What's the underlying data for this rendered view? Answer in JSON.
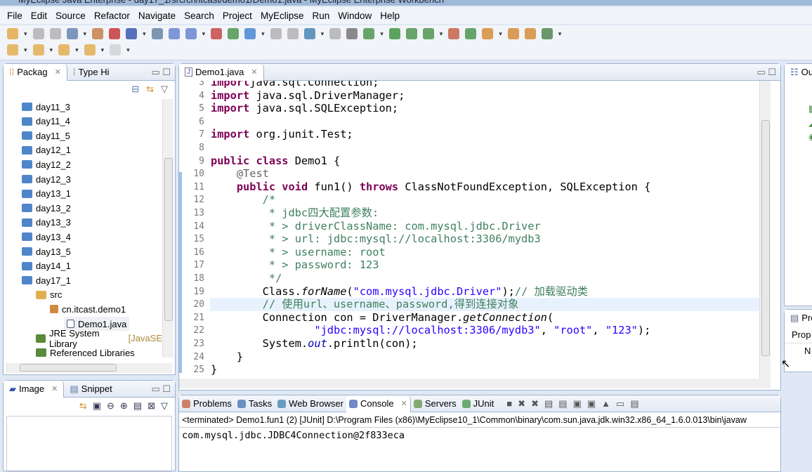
{
  "window": {
    "title": "MyEclipse Java Enterprise - day17_1/src/cn/itcast/demo1/Demo1.java - MyEclipse Enterprise Workbench"
  },
  "menu": [
    "File",
    "Edit",
    "Source",
    "Refactor",
    "Navigate",
    "Search",
    "Project",
    "MyEclipse",
    "Run",
    "Window",
    "Help"
  ],
  "package_explorer": {
    "tabs": [
      {
        "label": "Packag"
      },
      {
        "label": "Type Hi"
      }
    ],
    "items": [
      {
        "label": "day11_3",
        "depth": 0
      },
      {
        "label": "day11_4",
        "depth": 0
      },
      {
        "label": "day11_5",
        "depth": 0
      },
      {
        "label": "day12_1",
        "depth": 0
      },
      {
        "label": "day12_2",
        "depth": 0
      },
      {
        "label": "day12_3",
        "depth": 0
      },
      {
        "label": "day13_1",
        "depth": 0
      },
      {
        "label": "day13_2",
        "depth": 0
      },
      {
        "label": "day13_3",
        "depth": 0
      },
      {
        "label": "day13_4",
        "depth": 0
      },
      {
        "label": "day13_5",
        "depth": 0
      },
      {
        "label": "day14_1",
        "depth": 0
      },
      {
        "label": "day17_1",
        "depth": 0
      },
      {
        "label": "src",
        "depth": 1
      },
      {
        "label": "cn.itcast.demo1",
        "depth": 2
      },
      {
        "label": "Demo1.java",
        "depth": 3
      },
      {
        "label": "JRE System Library",
        "suffix": "[JavaSE",
        "depth": 1
      },
      {
        "label": "Referenced Libraries",
        "depth": 1
      }
    ]
  },
  "image_panel": {
    "tabs": [
      {
        "label": "Image"
      },
      {
        "label": "Snippet"
      }
    ]
  },
  "editor": {
    "tab": "Demo1.java",
    "highlighted_line": 20,
    "lines": [
      {
        "n": "3",
        "t": [
          [
            "kw",
            "import"
          ],
          [
            "",
            "java.sql.Connection;"
          ]
        ]
      },
      {
        "n": "4",
        "t": [
          [
            "kw",
            "import"
          ],
          [
            "",
            " java.sql.DriverManager;"
          ]
        ]
      },
      {
        "n": "5",
        "t": [
          [
            "kw",
            "import"
          ],
          [
            "",
            " java.sql.SQLException;"
          ]
        ]
      },
      {
        "n": "6",
        "t": []
      },
      {
        "n": "7",
        "t": [
          [
            "kw",
            "import"
          ],
          [
            "",
            " org.junit.Test;"
          ]
        ]
      },
      {
        "n": "8",
        "t": []
      },
      {
        "n": "9",
        "t": [
          [
            "kw",
            "public class"
          ],
          [
            "",
            " Demo1 {"
          ]
        ]
      },
      {
        "n": "10",
        "t": [
          [
            "",
            "    "
          ],
          [
            "an",
            "@Test"
          ]
        ]
      },
      {
        "n": "11",
        "t": [
          [
            "",
            "    "
          ],
          [
            "kw",
            "public void"
          ],
          [
            "",
            " fun1() "
          ],
          [
            "kw",
            "throws"
          ],
          [
            "",
            " ClassNotFoundException, SQLException {"
          ]
        ]
      },
      {
        "n": "12",
        "t": [
          [
            "cm",
            "        /*"
          ]
        ]
      },
      {
        "n": "13",
        "t": [
          [
            "cm",
            "         * jdbc四大配置参数:"
          ]
        ]
      },
      {
        "n": "14",
        "t": [
          [
            "cm",
            "         * > driverClassName: com.mysql.jdbc.Driver"
          ]
        ]
      },
      {
        "n": "15",
        "t": [
          [
            "cm",
            "         * > url: jdbc:mysql://localhost:3306/mydb3"
          ]
        ]
      },
      {
        "n": "16",
        "t": [
          [
            "cm",
            "         * > username: root"
          ]
        ]
      },
      {
        "n": "17",
        "t": [
          [
            "cm",
            "         * > password: 123"
          ]
        ]
      },
      {
        "n": "18",
        "t": [
          [
            "cm",
            "         */"
          ]
        ]
      },
      {
        "n": "19",
        "t": [
          [
            "",
            "        Class."
          ],
          [
            "it",
            "forName"
          ],
          [
            "",
            "("
          ],
          [
            "st",
            "\"com.mysql.jdbc.Driver\""
          ],
          [
            "",
            ");"
          ],
          [
            "cm",
            "// 加载驱动类"
          ]
        ]
      },
      {
        "n": "20",
        "t": [
          [
            "cm",
            "        // 使用url、username、password,得到连接对象"
          ]
        ]
      },
      {
        "n": "21",
        "t": [
          [
            "",
            "        Connection con = DriverManager."
          ],
          [
            "it",
            "getConnection"
          ],
          [
            "",
            "("
          ]
        ]
      },
      {
        "n": "22",
        "t": [
          [
            "",
            "                "
          ],
          [
            "st",
            "\"jdbc:mysql://localhost:3306/mydb3\""
          ],
          [
            "",
            ", "
          ],
          [
            "st",
            "\"root\""
          ],
          [
            "",
            ", "
          ],
          [
            "st",
            "\"123\""
          ],
          [
            "",
            ");"
          ]
        ]
      },
      {
        "n": "23",
        "t": [
          [
            "",
            "        System."
          ],
          [
            "fi",
            "out"
          ],
          [
            "",
            ".println(con);"
          ]
        ]
      },
      {
        "n": "24",
        "t": [
          [
            "",
            "    }"
          ]
        ]
      },
      {
        "n": "25",
        "t": [
          [
            "",
            "}"
          ]
        ]
      }
    ]
  },
  "console": {
    "tabs": [
      {
        "label": "Problems"
      },
      {
        "label": "Tasks"
      },
      {
        "label": "Web Browser"
      },
      {
        "label": "Console"
      },
      {
        "label": "Servers"
      },
      {
        "label": "JUnit"
      }
    ],
    "status": "<terminated> Demo1.fun1 (2) [JUnit] D:\\Program Files (x86)\\MyEclipse10_1\\Common\\binary\\com.sun.java.jdk.win32.x86_64_1.6.0.013\\bin\\javaw",
    "output": "com.mysql.jdbc.JDBC4Connection@2f833eca"
  },
  "outline": {
    "tab": "Ou"
  },
  "properties": {
    "tab": "Pro",
    "header": "Prop",
    "row": "N"
  }
}
